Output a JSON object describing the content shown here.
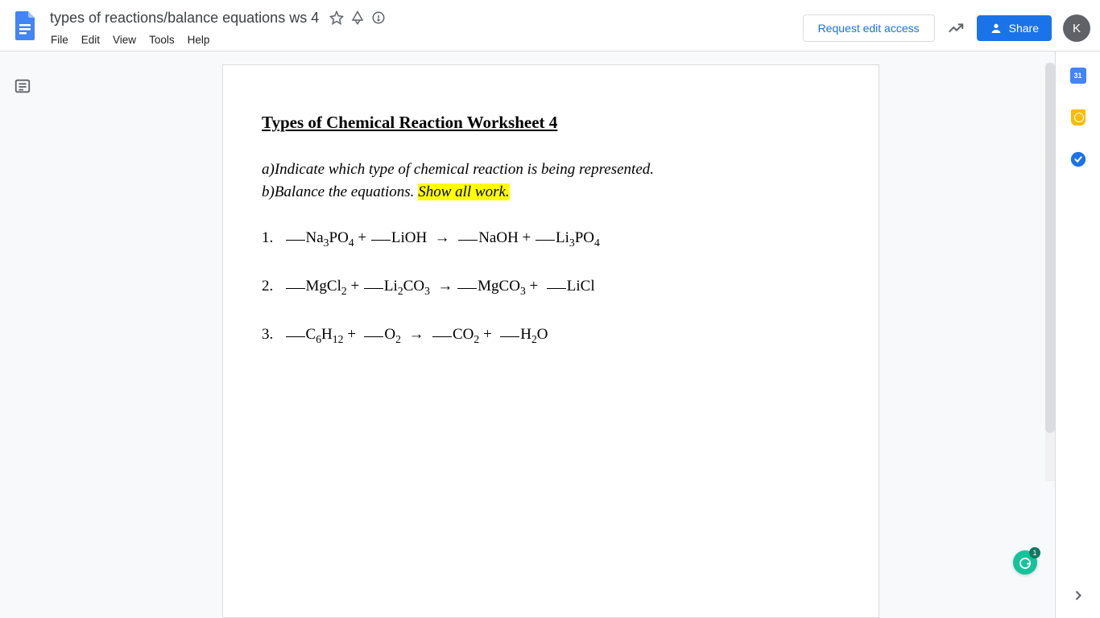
{
  "header": {
    "doc_title": "types of reactions/balance equations ws 4",
    "request_access_label": "Request edit access",
    "share_label": "Share",
    "avatar_letter": "K",
    "menus": {
      "file": "File",
      "edit": "Edit",
      "view": "View",
      "tools": "Tools",
      "help": "Help"
    }
  },
  "side": {
    "calendar_day": "31"
  },
  "document": {
    "title": "Types of Chemical Reaction Worksheet 4",
    "instruction_a": "a)Indicate which type of chemical reaction is being represented.",
    "instruction_b_prefix": "b)Balance the equations. ",
    "instruction_b_highlight": "Show all work.",
    "equations": {
      "eq1_num": "1.",
      "eq2_num": "2.",
      "eq3_num": "3."
    }
  },
  "grammarly": {
    "count": "1"
  }
}
